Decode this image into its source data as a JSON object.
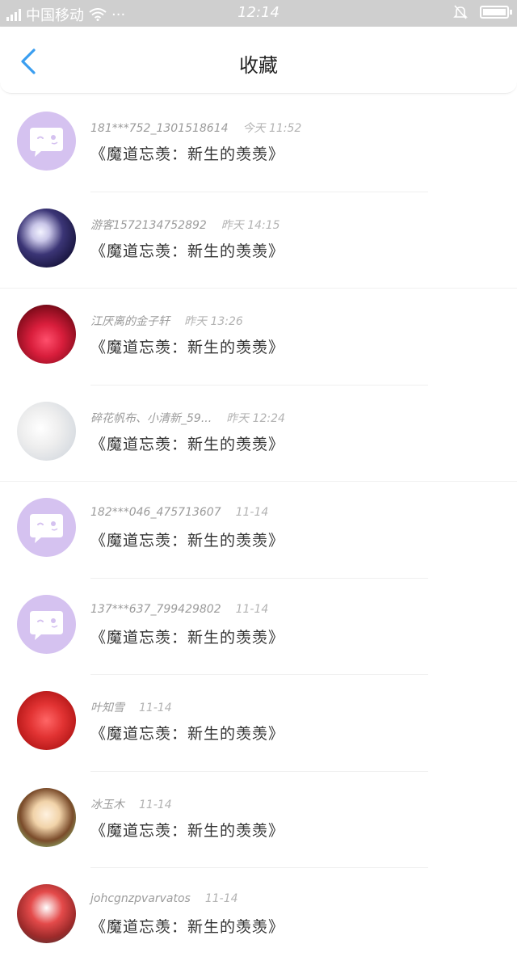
{
  "status_bar": {
    "carrier": "中国移动",
    "dots": "···",
    "time": "12:14"
  },
  "header": {
    "title": "收藏"
  },
  "items": [
    {
      "user": "181***752_1301518614",
      "time": "今天 11:52",
      "work": "《魔道忘羡：新生的羡羡》",
      "avatar": "chat-bubble-avatar"
    },
    {
      "user": "游客1572134752892",
      "time": "昨天 14:15",
      "work": "《魔道忘羡：新生的羡羡》",
      "avatar": "photo-avatar"
    },
    {
      "user": "江厌离的金子轩",
      "time": "昨天 13:26",
      "work": "《魔道忘羡：新生的羡羡》",
      "avatar": "photo-avatar"
    },
    {
      "user": "碎花帆布、小清新_59...",
      "time": "昨天 12:24",
      "work": "《魔道忘羡：新生的羡羡》",
      "avatar": "photo-avatar"
    },
    {
      "user": "182***046_475713607",
      "time": "11-14",
      "work": "《魔道忘羡：新生的羡羡》",
      "avatar": "chat-bubble-avatar"
    },
    {
      "user": "137***637_799429802",
      "time": "11-14",
      "work": "《魔道忘羡：新生的羡羡》",
      "avatar": "chat-bubble-avatar"
    },
    {
      "user": "叶知雪",
      "time": "11-14",
      "work": "《魔道忘羡：新生的羡羡》",
      "avatar": "photo-avatar"
    },
    {
      "user": "冰玉木",
      "time": "11-14",
      "work": "《魔道忘羡：新生的羡羡》",
      "avatar": "photo-avatar"
    },
    {
      "user": "johcgnzpvarvatos",
      "time": "11-14",
      "work": "《魔道忘羡：新生的羡羡》",
      "avatar": "photo-avatar"
    }
  ],
  "colors": {
    "accent": "#3a9ef0",
    "chat_avatar_bg": "#d5c2f0",
    "status_bar_bg": "#cfcfcf"
  }
}
